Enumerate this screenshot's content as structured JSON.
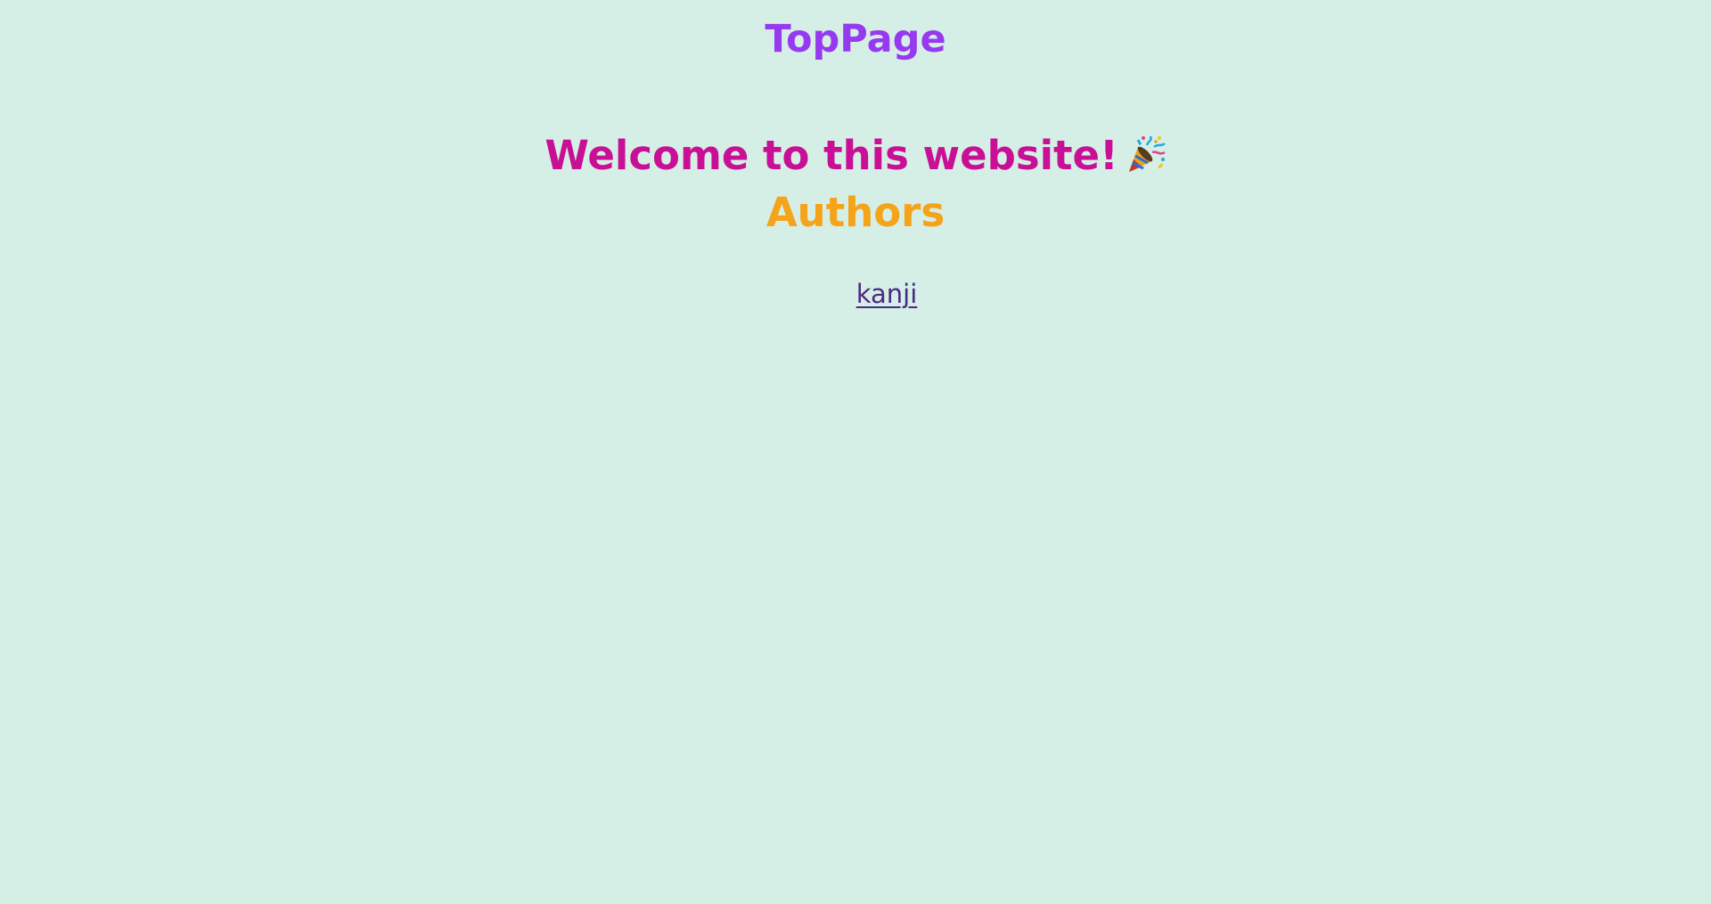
{
  "header": {
    "title": "TopPage"
  },
  "main": {
    "welcome_text": "Welcome to this website!",
    "welcome_icon": "party-popper-icon",
    "authors_heading": "Authors",
    "authors": [
      {
        "name": "kanji"
      }
    ]
  },
  "colors": {
    "background": "#d6efe6",
    "title": "#9639f0",
    "welcome": "#c80f96",
    "authors_heading": "#f5a318",
    "link": "#4b2a83"
  }
}
